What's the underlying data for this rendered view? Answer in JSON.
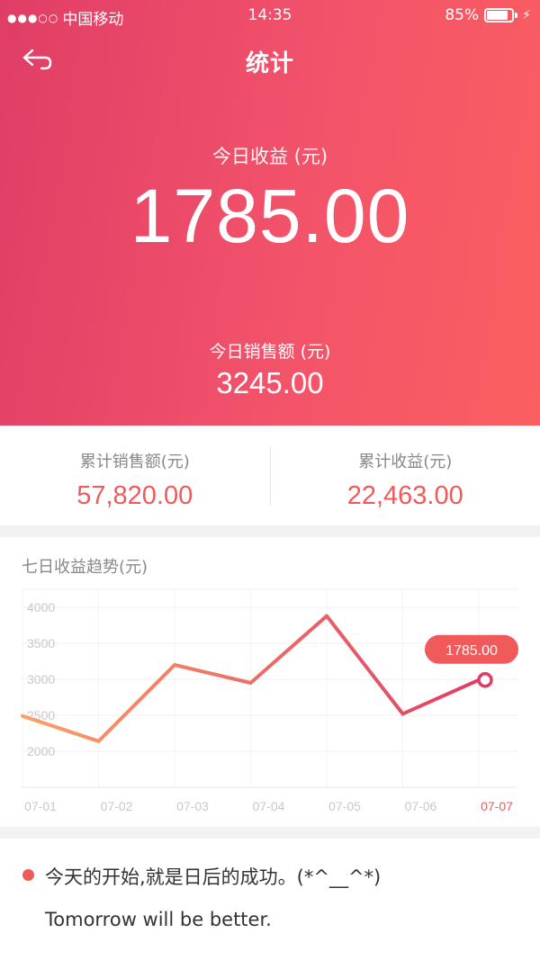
{
  "status_bar": {
    "signal": "●●●○○",
    "carrier": "中国移动",
    "time": "14:35",
    "battery": "85%",
    "battery_level": 0.85
  },
  "nav": {
    "back_icon": "back-arrow-icon",
    "title": "统计"
  },
  "today": {
    "profit_label": "今日收益 (元)",
    "profit_value": "1785.00",
    "sales_label": "今日销售额 (元)",
    "sales_value": "3245.00"
  },
  "totals": {
    "sales_label": "累计销售额(元)",
    "sales_value": "57,820.00",
    "profit_label": "累计收益(元)",
    "profit_value": "22,463.00"
  },
  "chart": {
    "title": "七日收益趋势(元)",
    "tooltip": "1785.00"
  },
  "chart_data": {
    "type": "line",
    "title": "七日收益趋势(元)",
    "x": [
      "07-01",
      "07-02",
      "07-03",
      "07-04",
      "07-05",
      "07-06",
      "07-07"
    ],
    "y_ticks": [
      2000,
      2500,
      3000,
      3500,
      4000
    ],
    "ylim": [
      1500,
      4250
    ],
    "series": [
      {
        "values": [
          2490,
          2140,
          3200,
          2950,
          3880,
          2520,
          2990
        ]
      }
    ],
    "highlight_index": 6,
    "highlight_label": "1785.00",
    "grid": true,
    "colors": {
      "start": "#fba06a",
      "end": "#e03d66",
      "highlight": "#f05a5a",
      "axis_text": "#c8c8c8"
    }
  },
  "motto": {
    "chinese": "今天的开始,就是日后的成功。(*^__^*)",
    "english": "Tomorrow will be better."
  },
  "colors": {
    "accent": "#f05a5a",
    "hero_start": "#e03d66",
    "hero_end": "#fb5f5f"
  }
}
